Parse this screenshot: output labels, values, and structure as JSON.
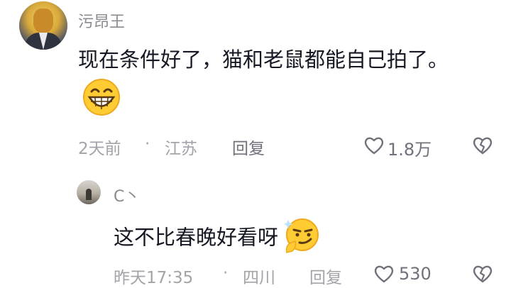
{
  "comment": {
    "username": "污昂王",
    "text": "现在条件好了，猫和老鼠都能自己拍了。",
    "emoji_icon": "grinning-face-icon",
    "time": "2天前",
    "separator": "·",
    "location": "江苏",
    "reply_label": "回复",
    "like_count": "1.8万"
  },
  "reply": {
    "username": "C丶",
    "text": "这不比春晚好看呀",
    "emoji_icon": "smirking-face-icon",
    "time": "昨天17:35",
    "separator": "·",
    "location": "四川",
    "reply_label": "回复",
    "like_count": "530"
  }
}
